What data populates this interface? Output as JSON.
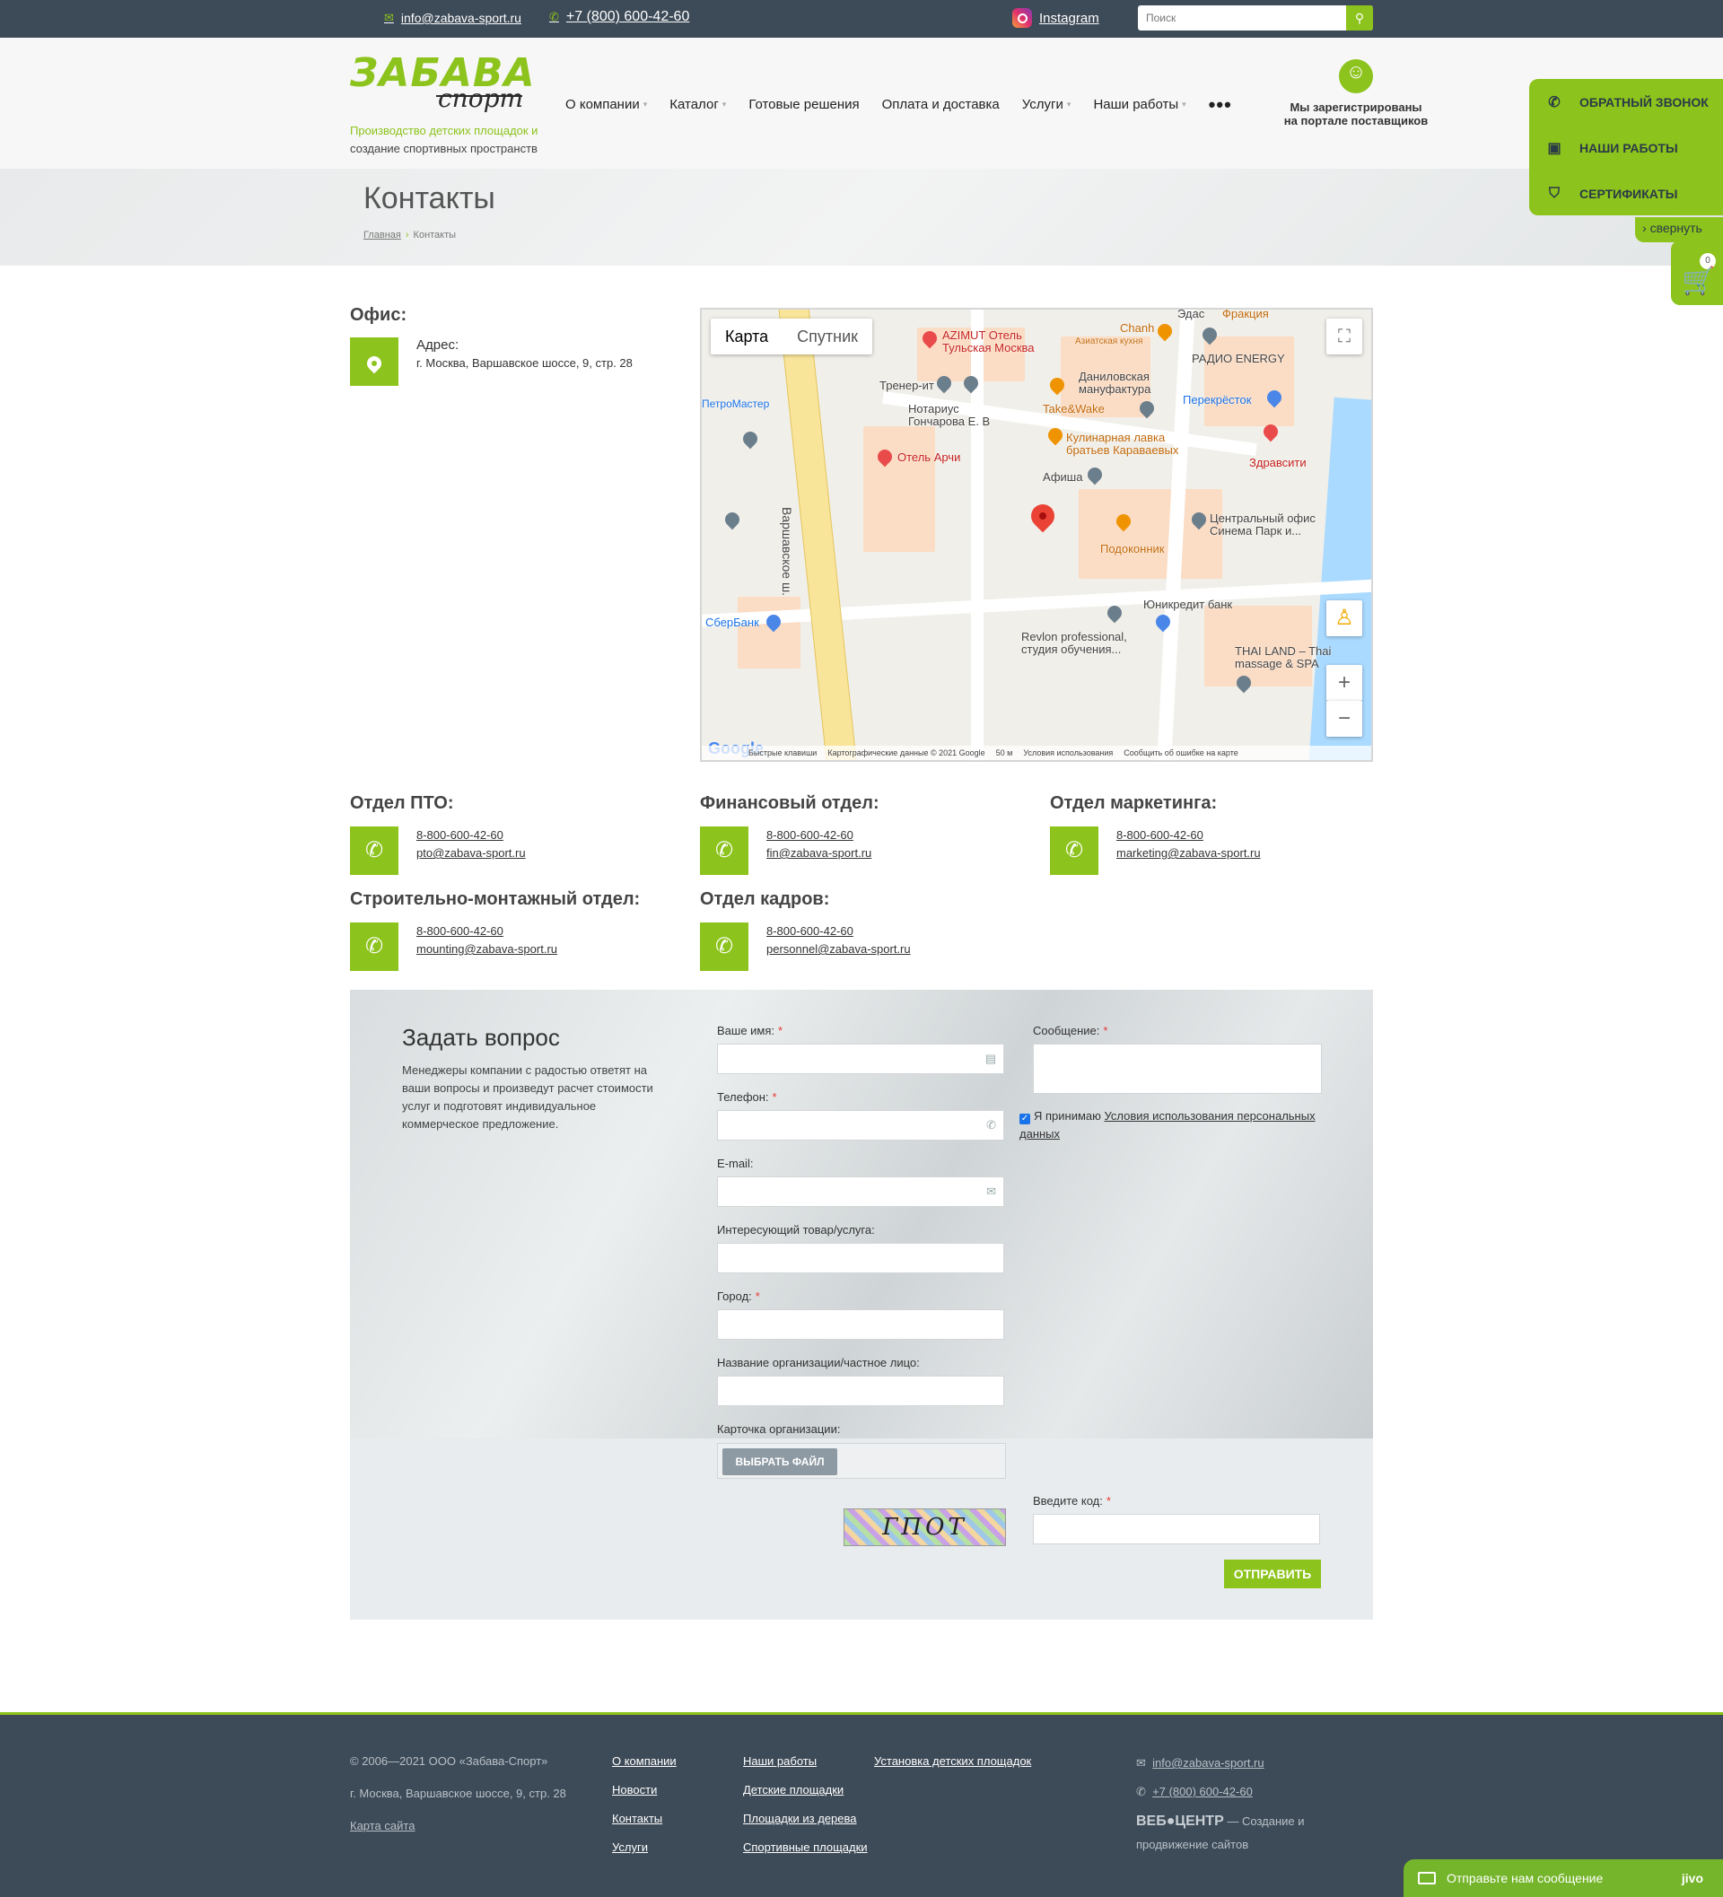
{
  "topbar": {
    "email": "info@zabava-sport.ru",
    "phone": "+7 (800) 600-42-60",
    "instagram": "Instagram",
    "search_placeholder": "Поиск"
  },
  "header": {
    "logo_top": "ЗАБАВА",
    "logo_bottom": "спорт",
    "slogan_green": "Производство детских площадок и",
    "slogan_dark": "создание спортивных пространств",
    "nav": [
      "О компании",
      "Каталог",
      "Готовые решения",
      "Оплата и доставка",
      "Услуги",
      "Наши работы"
    ],
    "nav_more": "•••",
    "registered_line1": "Мы зарегистрированы",
    "registered_line2": "на портале поставщиков"
  },
  "side_panel": {
    "items": [
      "ОБРАТНЫЙ ЗВОНОК",
      "НАШИ РАБОТЫ",
      "СЕРТИФИКАТЫ"
    ],
    "collapse": "свернуть",
    "cart_count": "0"
  },
  "page": {
    "title": "Контакты",
    "breadcrumb_home": "Главная",
    "breadcrumb_current": "Контакты"
  },
  "office": {
    "title": "Офис:",
    "address_label": "Адрес:",
    "address": "г. Москва, Варшавское шоссе, 9, стр. 28"
  },
  "map": {
    "tab_map": "Карта",
    "tab_satellite": "Спутник",
    "labels": [
      "AZIMUT Отель Тульская Москва",
      "Chanh",
      "Азиатская кухня",
      "РАДИО ENERGY",
      "Тренер-ит",
      "Даниловская мануфактура",
      "Перекрёсток",
      "ПетроМастер",
      "Нотариус Гончарова Е. В",
      "Take&Wake",
      "Кулинарная лавка братьев Караваевых",
      "Здравсити",
      "Отель Арчи",
      "Варшавское ш.",
      "Афиша",
      "Центральный офис Синема Парк и...",
      "Подоконник",
      "Юникредит банк",
      "СберБанк",
      "Revlon professional, студия обучения...",
      "THAI LAND – Thai massage & SPA",
      "Эдас",
      "Фракция"
    ],
    "attribution": [
      "Быстрые клавиши",
      "Картографические данные © 2021 Google",
      "50 м",
      "Условия использования",
      "Сообщить об ошибке на карте"
    ]
  },
  "departments": [
    {
      "title": "Отдел ПТО:",
      "phone": "8-800-600-42-60",
      "email": "pto@zabava-sport.ru"
    },
    {
      "title": "Финансовый отдел:",
      "phone": "8-800-600-42-60",
      "email": "fin@zabava-sport.ru"
    },
    {
      "title": "Отдел маркетинга:",
      "phone": "8-800-600-42-60",
      "email": "marketing@zabava-sport.ru"
    },
    {
      "title": "Строительно-монтажный отдел:",
      "phone": "8-800-600-42-60",
      "email": " mounting@zabava-sport.ru"
    },
    {
      "title": "Отдел кадров:",
      "phone": "8-800-600-42-60",
      "email": "personnel@zabava-sport.ru"
    }
  ],
  "form": {
    "title": "Задать вопрос",
    "lead": "Менеджеры компании с радостью ответят на ваши вопросы и произведут расчет стоимости услуг и подготовят индивидуальное коммерческое предложение.",
    "name_label": "Ваше имя:",
    "phone_label": "Телефон:",
    "email_label": "E-mail:",
    "product_label": "Интересующий товар/услуга:",
    "city_label": "Город:",
    "org_label": "Название организации/частное лицо:",
    "card_label": "Карточка организации:",
    "file_button": "ВЫБРАТЬ ФАЙЛ",
    "message_label": "Сообщение:",
    "agree_text": "Я принимаю",
    "agree_link": "Условия использования персональных данных",
    "captcha_label": "Введите код:",
    "captcha_text": "ГПОТ",
    "submit": "ОТПРАВИТЬ",
    "required_mark": "*"
  },
  "footer": {
    "copyright": "© 2006—2021   ООО «Забава-Спорт»",
    "address": "г. Москва, Варшавское шоссе, 9, стр. 28",
    "sitemap": "Карта сайта",
    "col1": [
      "О компании",
      "Новости",
      "Контакты",
      "Услуги"
    ],
    "col2": [
      "Наши работы",
      "Детские площадки",
      "Площадки из дерева",
      "Спортивные площадки"
    ],
    "col3": [
      "Установка детских площадок"
    ],
    "email": "info@zabava-sport.ru",
    "phone": "+7 (800) 600-42-60",
    "webcenter_brand": "ВЕБ●ЦЕНТР",
    "webcenter_text": "— Создание и продвижение сайтов"
  },
  "jivo": {
    "text": "Отправьте нам сообщение",
    "brand": "jivo"
  },
  "colors": {
    "accent": "#8cc31c",
    "dark": "#3d4a57"
  }
}
